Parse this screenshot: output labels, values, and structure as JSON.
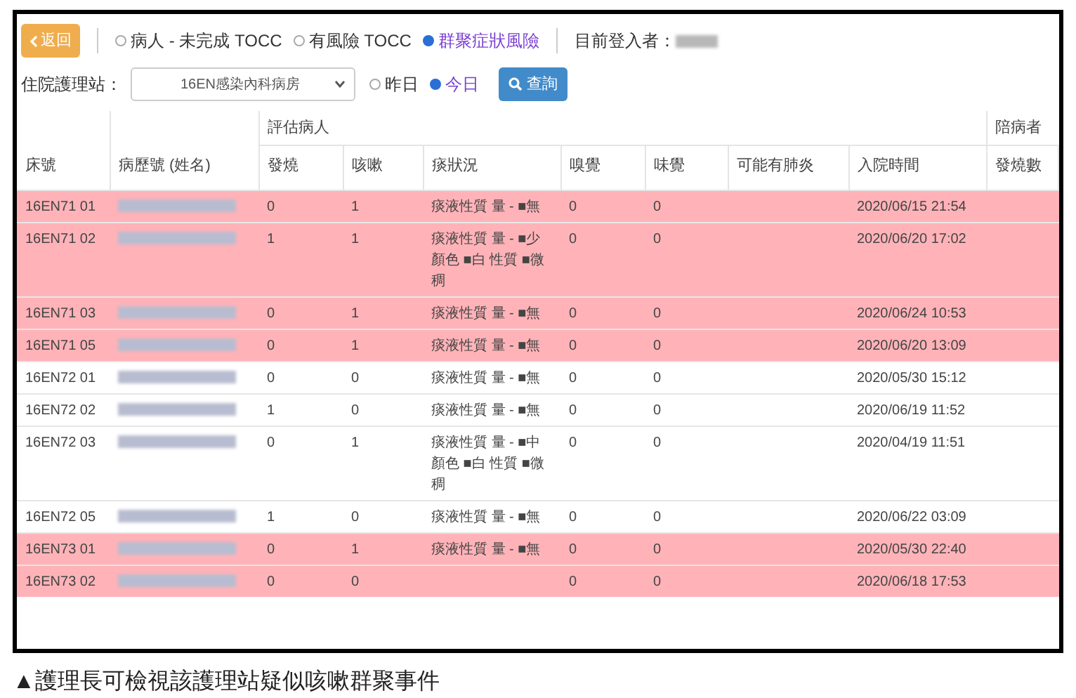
{
  "toolbar": {
    "back_button": "返回",
    "view_options": [
      {
        "label": "病人 - 未完成 TOCC",
        "selected": false
      },
      {
        "label": "有風險 TOCC",
        "selected": false
      },
      {
        "label": "群聚症狀風險",
        "selected": true
      }
    ],
    "logged_in_label": "目前登入者："
  },
  "filter": {
    "station_label": "住院護理站：",
    "station_value": "16EN感染內科病房",
    "date_options": [
      {
        "label": "昨日",
        "selected": false
      },
      {
        "label": "今日",
        "selected": true
      }
    ],
    "query_button": "查詢"
  },
  "table": {
    "group_headers": [
      "評估病人",
      "陪病者"
    ],
    "columns": [
      "床號",
      "病歷號 (姓名)",
      "發燒",
      "咳嗽",
      "痰狀況",
      "嗅覺",
      "味覺",
      "可能有肺炎",
      "入院時間",
      "發燒數"
    ],
    "rows": [
      {
        "highlighted": true,
        "cells": [
          "16EN71 01",
          "",
          "0",
          "1",
          "痰液性質 量 - ■無",
          "0",
          "0",
          "",
          "2020/06/15 21:54",
          ""
        ]
      },
      {
        "highlighted": true,
        "cells": [
          "16EN71 02",
          "",
          "1",
          "1",
          "痰液性質 量 - ■少顏色 ■白 性質 ■微稠",
          "0",
          "0",
          "",
          "2020/06/20 17:02",
          ""
        ]
      },
      {
        "highlighted": true,
        "cells": [
          "16EN71 03",
          "",
          "0",
          "1",
          "痰液性質 量 - ■無",
          "0",
          "0",
          "",
          "2020/06/24 10:53",
          ""
        ]
      },
      {
        "highlighted": true,
        "cells": [
          "16EN71 05",
          "",
          "0",
          "1",
          "痰液性質 量 - ■無",
          "0",
          "0",
          "",
          "2020/06/20 13:09",
          ""
        ]
      },
      {
        "highlighted": false,
        "cells": [
          "16EN72 01",
          "",
          "0",
          "0",
          "痰液性質 量 - ■無",
          "0",
          "0",
          "",
          "2020/05/30 15:12",
          ""
        ]
      },
      {
        "highlighted": false,
        "cells": [
          "16EN72 02",
          "",
          "1",
          "0",
          "痰液性質 量 - ■無",
          "0",
          "0",
          "",
          "2020/06/19 11:52",
          ""
        ]
      },
      {
        "highlighted": false,
        "cells": [
          "16EN72 03",
          "",
          "0",
          "1",
          "痰液性質 量 - ■中顏色 ■白 性質 ■微稠",
          "0",
          "0",
          "",
          "2020/04/19 11:51",
          ""
        ]
      },
      {
        "highlighted": false,
        "cells": [
          "16EN72 05",
          "",
          "1",
          "0",
          "痰液性質 量 - ■無",
          "0",
          "0",
          "",
          "2020/06/22 03:09",
          ""
        ]
      },
      {
        "highlighted": true,
        "cells": [
          "16EN73 01",
          "",
          "0",
          "1",
          "痰液性質 量 - ■無",
          "0",
          "0",
          "",
          "2020/05/30 22:40",
          ""
        ]
      },
      {
        "highlighted": true,
        "cells": [
          "16EN73 02",
          "",
          "0",
          "0",
          "",
          "0",
          "0",
          "",
          "2020/06/18 17:53",
          ""
        ]
      }
    ]
  },
  "caption": "▲護理長可檢視該護理站疑似咳嗽群聚事件"
}
